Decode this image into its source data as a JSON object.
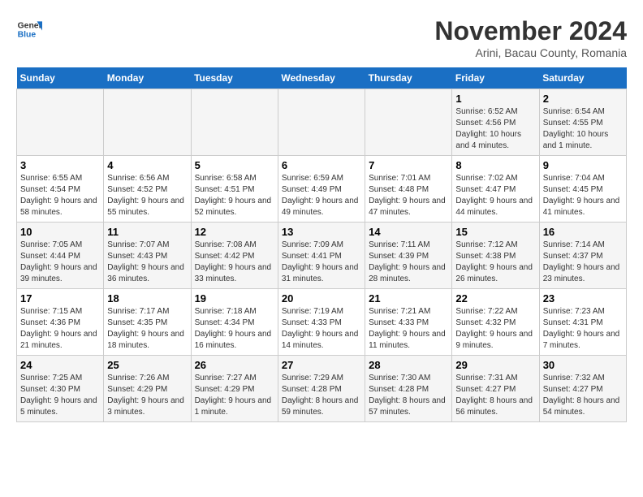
{
  "logo": {
    "line1": "General",
    "line2": "Blue"
  },
  "title": "November 2024",
  "subtitle": "Arini, Bacau County, Romania",
  "days_of_week": [
    "Sunday",
    "Monday",
    "Tuesday",
    "Wednesday",
    "Thursday",
    "Friday",
    "Saturday"
  ],
  "weeks": [
    [
      {
        "day": "",
        "info": ""
      },
      {
        "day": "",
        "info": ""
      },
      {
        "day": "",
        "info": ""
      },
      {
        "day": "",
        "info": ""
      },
      {
        "day": "",
        "info": ""
      },
      {
        "day": "1",
        "info": "Sunrise: 6:52 AM\nSunset: 4:56 PM\nDaylight: 10 hours and 4 minutes."
      },
      {
        "day": "2",
        "info": "Sunrise: 6:54 AM\nSunset: 4:55 PM\nDaylight: 10 hours and 1 minute."
      }
    ],
    [
      {
        "day": "3",
        "info": "Sunrise: 6:55 AM\nSunset: 4:54 PM\nDaylight: 9 hours and 58 minutes."
      },
      {
        "day": "4",
        "info": "Sunrise: 6:56 AM\nSunset: 4:52 PM\nDaylight: 9 hours and 55 minutes."
      },
      {
        "day": "5",
        "info": "Sunrise: 6:58 AM\nSunset: 4:51 PM\nDaylight: 9 hours and 52 minutes."
      },
      {
        "day": "6",
        "info": "Sunrise: 6:59 AM\nSunset: 4:49 PM\nDaylight: 9 hours and 49 minutes."
      },
      {
        "day": "7",
        "info": "Sunrise: 7:01 AM\nSunset: 4:48 PM\nDaylight: 9 hours and 47 minutes."
      },
      {
        "day": "8",
        "info": "Sunrise: 7:02 AM\nSunset: 4:47 PM\nDaylight: 9 hours and 44 minutes."
      },
      {
        "day": "9",
        "info": "Sunrise: 7:04 AM\nSunset: 4:45 PM\nDaylight: 9 hours and 41 minutes."
      }
    ],
    [
      {
        "day": "10",
        "info": "Sunrise: 7:05 AM\nSunset: 4:44 PM\nDaylight: 9 hours and 39 minutes."
      },
      {
        "day": "11",
        "info": "Sunrise: 7:07 AM\nSunset: 4:43 PM\nDaylight: 9 hours and 36 minutes."
      },
      {
        "day": "12",
        "info": "Sunrise: 7:08 AM\nSunset: 4:42 PM\nDaylight: 9 hours and 33 minutes."
      },
      {
        "day": "13",
        "info": "Sunrise: 7:09 AM\nSunset: 4:41 PM\nDaylight: 9 hours and 31 minutes."
      },
      {
        "day": "14",
        "info": "Sunrise: 7:11 AM\nSunset: 4:39 PM\nDaylight: 9 hours and 28 minutes."
      },
      {
        "day": "15",
        "info": "Sunrise: 7:12 AM\nSunset: 4:38 PM\nDaylight: 9 hours and 26 minutes."
      },
      {
        "day": "16",
        "info": "Sunrise: 7:14 AM\nSunset: 4:37 PM\nDaylight: 9 hours and 23 minutes."
      }
    ],
    [
      {
        "day": "17",
        "info": "Sunrise: 7:15 AM\nSunset: 4:36 PM\nDaylight: 9 hours and 21 minutes."
      },
      {
        "day": "18",
        "info": "Sunrise: 7:17 AM\nSunset: 4:35 PM\nDaylight: 9 hours and 18 minutes."
      },
      {
        "day": "19",
        "info": "Sunrise: 7:18 AM\nSunset: 4:34 PM\nDaylight: 9 hours and 16 minutes."
      },
      {
        "day": "20",
        "info": "Sunrise: 7:19 AM\nSunset: 4:33 PM\nDaylight: 9 hours and 14 minutes."
      },
      {
        "day": "21",
        "info": "Sunrise: 7:21 AM\nSunset: 4:33 PM\nDaylight: 9 hours and 11 minutes."
      },
      {
        "day": "22",
        "info": "Sunrise: 7:22 AM\nSunset: 4:32 PM\nDaylight: 9 hours and 9 minutes."
      },
      {
        "day": "23",
        "info": "Sunrise: 7:23 AM\nSunset: 4:31 PM\nDaylight: 9 hours and 7 minutes."
      }
    ],
    [
      {
        "day": "24",
        "info": "Sunrise: 7:25 AM\nSunset: 4:30 PM\nDaylight: 9 hours and 5 minutes."
      },
      {
        "day": "25",
        "info": "Sunrise: 7:26 AM\nSunset: 4:29 PM\nDaylight: 9 hours and 3 minutes."
      },
      {
        "day": "26",
        "info": "Sunrise: 7:27 AM\nSunset: 4:29 PM\nDaylight: 9 hours and 1 minute."
      },
      {
        "day": "27",
        "info": "Sunrise: 7:29 AM\nSunset: 4:28 PM\nDaylight: 8 hours and 59 minutes."
      },
      {
        "day": "28",
        "info": "Sunrise: 7:30 AM\nSunset: 4:28 PM\nDaylight: 8 hours and 57 minutes."
      },
      {
        "day": "29",
        "info": "Sunrise: 7:31 AM\nSunset: 4:27 PM\nDaylight: 8 hours and 56 minutes."
      },
      {
        "day": "30",
        "info": "Sunrise: 7:32 AM\nSunset: 4:27 PM\nDaylight: 8 hours and 54 minutes."
      }
    ]
  ]
}
